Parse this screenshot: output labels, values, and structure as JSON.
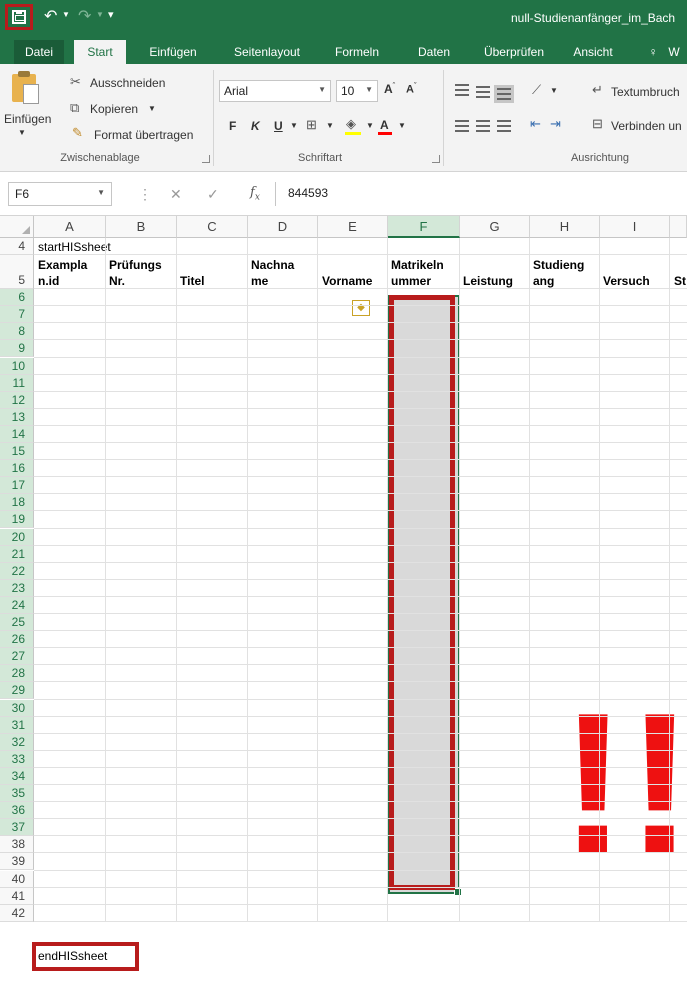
{
  "window": {
    "title": "null-Studienanfänger_im_Bach",
    "qat": {
      "save_icon": "save-icon",
      "undo_icon": "undo-icon",
      "redo_icon": "redo-icon"
    }
  },
  "ribbon": {
    "tabs": [
      {
        "label": "Datei"
      },
      {
        "label": "Start"
      },
      {
        "label": "Einfügen"
      },
      {
        "label": "Seitenlayout"
      },
      {
        "label": "Formeln"
      },
      {
        "label": "Daten"
      },
      {
        "label": "Überprüfen"
      },
      {
        "label": "Ansicht"
      },
      {
        "label": "W"
      }
    ],
    "clipboard": {
      "paste": "Einfügen",
      "cut": "Ausschneiden",
      "copy": "Kopieren",
      "format_painter": "Format übertragen",
      "group_label": "Zwischenablage"
    },
    "font": {
      "name": "Arial",
      "size": "10",
      "bold": "F",
      "italic": "K",
      "underline": "U",
      "group_label": "Schriftart"
    },
    "alignment": {
      "wrap": "Textumbruch",
      "merge": "Verbinden un",
      "group_label": "Ausrichtung"
    }
  },
  "formula_bar": {
    "name_box": "F6",
    "formula": "844593"
  },
  "grid": {
    "columns": [
      "A",
      "B",
      "C",
      "D",
      "E",
      "F",
      "G",
      "H",
      "I"
    ],
    "selected_column": "F",
    "rows": [
      "4",
      "5",
      "6",
      "7",
      "8",
      "9",
      "10",
      "11",
      "12",
      "13",
      "14",
      "15",
      "16",
      "17",
      "18",
      "19",
      "20",
      "21",
      "22",
      "23",
      "24",
      "25",
      "26",
      "27",
      "28",
      "29",
      "30",
      "31",
      "32",
      "33",
      "34",
      "35",
      "36",
      "37",
      "38",
      "39",
      "40",
      "41",
      "42"
    ],
    "cells": {
      "A4": "startHISsheet",
      "A5_line1": "Exampla",
      "A5_line2": "n.id",
      "B5_line1": "Prüfungs",
      "B5_line2": "Nr.",
      "C5": "Titel",
      "D5_line1": "Nachna",
      "D5_line2": "me",
      "E5": "Vorname",
      "F5_line1": "Matrikeln",
      "F5_line2": "ummer",
      "G5": "Leistung",
      "H5_line1": "Studieng",
      "H5_line2": "ang",
      "I5": "Versuch",
      "J5": "St",
      "A41": "endHISsheet"
    },
    "annotation": "!!"
  }
}
